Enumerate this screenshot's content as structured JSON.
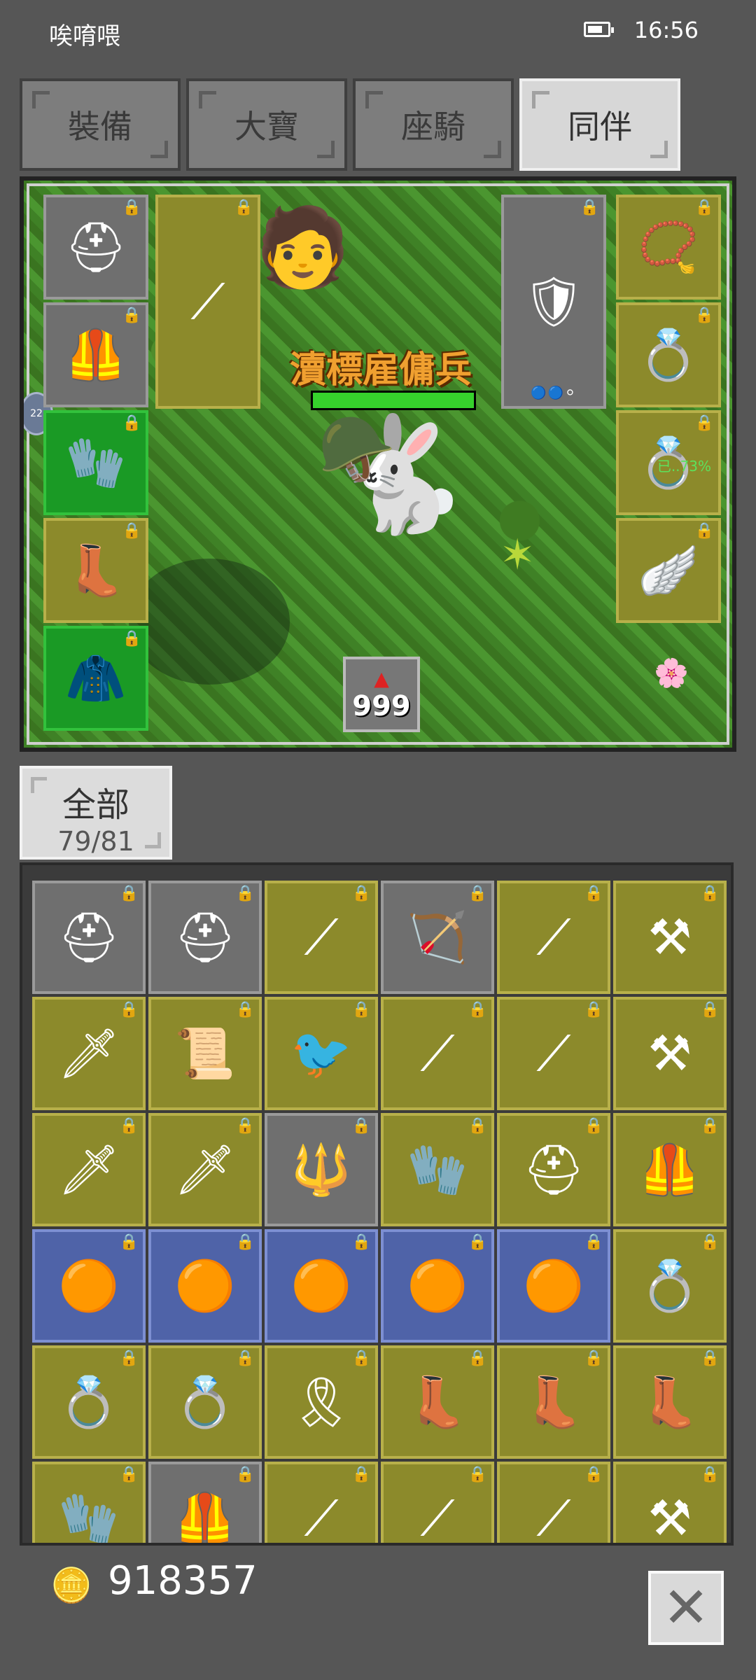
{
  "status_bar": {
    "app_name": "唉唷喂",
    "time": "16:56"
  },
  "tabs": [
    {
      "label": "裝備",
      "active": false
    },
    {
      "label": "大寶",
      "active": false
    },
    {
      "label": "座騎",
      "active": false
    },
    {
      "label": "同伴",
      "active": true
    }
  ],
  "scene": {
    "mercenary_name": "瀆標雇傭兵",
    "hp_fraction": 1.0,
    "counter_value": "999",
    "side_tag": "22",
    "ring_percent": "已..73%"
  },
  "left_slots": [
    {
      "icon": "helmet",
      "style": "grey"
    },
    {
      "icon": "armor",
      "style": "grey"
    },
    {
      "icon": "gloves",
      "style": "green"
    },
    {
      "icon": "boots",
      "style": "gold"
    },
    {
      "icon": "cape",
      "style": "green"
    }
  ],
  "weapon_slot": {
    "icon": "spear",
    "style": "gold"
  },
  "shield_slot": {
    "icon": "shield",
    "style": "grey"
  },
  "right_slots": [
    {
      "icon": "necklace",
      "style": "gold"
    },
    {
      "icon": "ring-purple",
      "style": "gold"
    },
    {
      "icon": "ring-green",
      "style": "gold"
    },
    {
      "icon": "wings",
      "style": "gold"
    }
  ],
  "filter": {
    "label": "全部",
    "count": "79/81"
  },
  "inventory": [
    {
      "icon": "helmet",
      "style": "grey"
    },
    {
      "icon": "helmet",
      "style": "grey"
    },
    {
      "icon": "spear",
      "style": "gold"
    },
    {
      "icon": "bow",
      "style": "grey"
    },
    {
      "icon": "spear",
      "style": "gold"
    },
    {
      "icon": "hammer",
      "style": "gold"
    },
    {
      "icon": "dagger",
      "style": "gold"
    },
    {
      "icon": "scroll",
      "style": "gold"
    },
    {
      "icon": "bird",
      "style": "gold"
    },
    {
      "icon": "spear",
      "style": "gold"
    },
    {
      "icon": "spear",
      "style": "gold"
    },
    {
      "icon": "hammer",
      "style": "gold"
    },
    {
      "icon": "dagger",
      "style": "gold"
    },
    {
      "icon": "dagger",
      "style": "gold"
    },
    {
      "icon": "trident",
      "style": "grey"
    },
    {
      "icon": "gauntlet",
      "style": "gold"
    },
    {
      "icon": "helmet",
      "style": "gold"
    },
    {
      "icon": "armor",
      "style": "gold"
    },
    {
      "icon": "orb",
      "style": "blue"
    },
    {
      "icon": "orb",
      "style": "blue"
    },
    {
      "icon": "orb",
      "style": "blue"
    },
    {
      "icon": "orb",
      "style": "blue"
    },
    {
      "icon": "orb",
      "style": "blue"
    },
    {
      "icon": "ring-black",
      "style": "gold"
    },
    {
      "icon": "ring-blue",
      "style": "gold"
    },
    {
      "icon": "ring-blue",
      "style": "gold"
    },
    {
      "icon": "belt",
      "style": "gold"
    },
    {
      "icon": "boots",
      "style": "gold"
    },
    {
      "icon": "boots",
      "style": "gold"
    },
    {
      "icon": "boots",
      "style": "gold"
    },
    {
      "icon": "gauntlet",
      "style": "gold"
    },
    {
      "icon": "armor",
      "style": "grey"
    },
    {
      "icon": "spear",
      "style": "gold"
    },
    {
      "icon": "spear",
      "style": "gold"
    },
    {
      "icon": "spear",
      "style": "gold"
    },
    {
      "icon": "hammer",
      "style": "gold"
    }
  ],
  "currency": {
    "gold": "918357"
  },
  "colors": {
    "background": "#565656",
    "slot_gold": "#8c8a2b",
    "slot_grey": "#6f6f6f",
    "slot_green": "#1a9a25",
    "slot_blue": "#4f63a8",
    "name_text": "#f0a030"
  }
}
